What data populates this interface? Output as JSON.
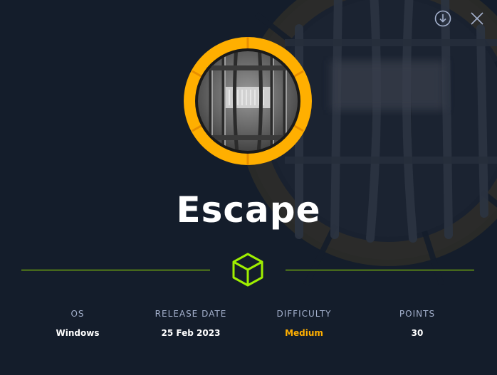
{
  "machine": {
    "name": "Escape",
    "accent_color": "#ffaf00",
    "divider_color": "#9fef00"
  },
  "header": {
    "download_icon": "download-circle-icon",
    "close_icon": "close-icon"
  },
  "details": [
    {
      "label": "OS",
      "value": "Windows"
    },
    {
      "label": "RELEASE DATE",
      "value": "25 Feb 2023"
    },
    {
      "label": "DIFFICULTY",
      "value": "Medium",
      "color": "#ffaf00"
    },
    {
      "label": "POINTS",
      "value": "30"
    }
  ]
}
